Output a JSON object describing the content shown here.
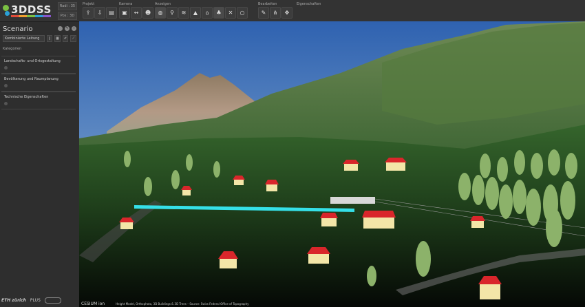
{
  "app": {
    "logo_text": "3DDSS",
    "nav_boxes": [
      "Radi : 35",
      "Pos : 3D"
    ]
  },
  "toolbar": {
    "groups": [
      {
        "label": "Projekt",
        "buttons": [
          "upload-icon",
          "download-icon",
          "folder-icon"
        ]
      },
      {
        "label": "Kamera",
        "buttons": [
          "camera-icon",
          "measure-icon",
          "person-icon"
        ]
      },
      {
        "label": "Anzeigen",
        "buttons": [
          "globe-icon",
          "walk-icon",
          "layers-icon",
          "terrain-icon",
          "building-icon",
          "tree-icon",
          "powerline-icon",
          "globe-outline-icon"
        ]
      },
      {
        "label": "Bearbeiten",
        "buttons": [
          "edit-icon",
          "network-icon",
          "move-icon"
        ]
      },
      {
        "label": "Eigenschaften",
        "buttons": []
      }
    ]
  },
  "sidebar": {
    "title": "Scenario",
    "select_value": "Kombinierte Leitung",
    "section_label": "Kategorien",
    "categories": [
      "Landschafts- und Ortsgestaltung",
      "Bevölkerung und Raumplanung",
      "Technische Eigenschaften"
    ],
    "footer": [
      "ETH zürich",
      "PLUS"
    ]
  },
  "viewport": {
    "credit_cesium": "CESIUM ion",
    "credit_text": "Height Model, Orthophoto, 3D Buildings & 3D Trees – Source: Swiss Federal Office of Topography"
  },
  "colors": {
    "sky": "#3b6fb8",
    "cable": "#35e0e8",
    "roof": "#d9262b",
    "wall": "#f3e6a8",
    "tree": "#8cb26a"
  }
}
